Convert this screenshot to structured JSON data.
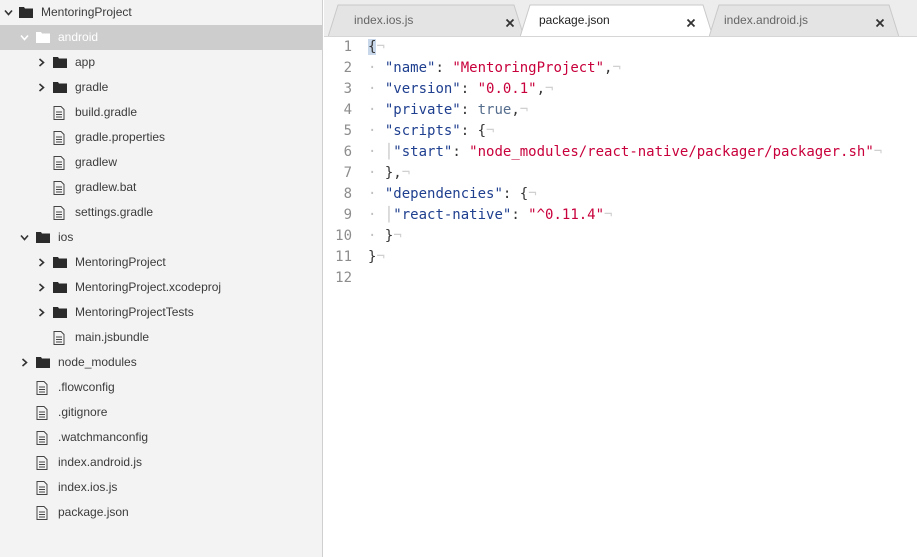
{
  "sidebar": {
    "root": "MentoringProject",
    "android": {
      "label": "android",
      "items": [
        {
          "label": "app",
          "kind": "folder"
        },
        {
          "label": "gradle",
          "kind": "folder"
        },
        {
          "label": "build.gradle",
          "kind": "file"
        },
        {
          "label": "gradle.properties",
          "kind": "file"
        },
        {
          "label": "gradlew",
          "kind": "file"
        },
        {
          "label": "gradlew.bat",
          "kind": "file"
        },
        {
          "label": "settings.gradle",
          "kind": "file"
        }
      ]
    },
    "ios": {
      "label": "ios",
      "items": [
        {
          "label": "MentoringProject",
          "kind": "folder"
        },
        {
          "label": "MentoringProject.xcodeproj",
          "kind": "folder"
        },
        {
          "label": "MentoringProjectTests",
          "kind": "folder"
        },
        {
          "label": "main.jsbundle",
          "kind": "file"
        }
      ]
    },
    "root_items": [
      {
        "label": "node_modules",
        "kind": "folder"
      },
      {
        "label": ".flowconfig",
        "kind": "file"
      },
      {
        "label": ".gitignore",
        "kind": "file"
      },
      {
        "label": ".watchmanconfig",
        "kind": "file"
      },
      {
        "label": "index.android.js",
        "kind": "file"
      },
      {
        "label": "index.ios.js",
        "kind": "file"
      },
      {
        "label": "package.json",
        "kind": "file"
      }
    ]
  },
  "tabs": [
    {
      "label": "index.ios.js",
      "active": false
    },
    {
      "label": "package.json",
      "active": true
    },
    {
      "label": "index.android.js",
      "active": false
    }
  ],
  "editor": {
    "line_numbers": [
      "1",
      "2",
      "3",
      "4",
      "5",
      "6",
      "7",
      "8",
      "9",
      "10",
      "11",
      "12"
    ],
    "lines": {
      "l2": {
        "key": "\"name\"",
        "sep": ": ",
        "val": "\"MentoringProject\"",
        "end": ","
      },
      "l3": {
        "key": "\"version\"",
        "sep": ": ",
        "val": "\"0.0.1\"",
        "end": ","
      },
      "l4": {
        "key": "\"private\"",
        "sep": ": ",
        "val": "true",
        "end": ","
      },
      "l5": {
        "key": "\"scripts\"",
        "sep": ": ",
        "val": "{"
      },
      "l6": {
        "key": "\"start\"",
        "sep": ": ",
        "val": "\"node_modules/react-native/packager/packager.sh\""
      },
      "l7": {
        "val": "},"
      },
      "l8": {
        "key": "\"dependencies\"",
        "sep": ": ",
        "val": "{"
      },
      "l9": {
        "key": "\"react-native\"",
        "sep": ": ",
        "val": "\"^0.11.4\""
      },
      "l10": {
        "val": "}"
      },
      "l1": {
        "val": "{"
      },
      "l11": {
        "val": "}"
      }
    },
    "eol_marker": "¬",
    "indent_dot": "·"
  },
  "colors": {
    "sidebar_bg": "#f3f3f3",
    "selected_row": "#cdcdcd",
    "key": "#1f3f8f",
    "string": "#c8003b",
    "keyword": "#556d8d",
    "gutter": "#8d8d8d"
  }
}
